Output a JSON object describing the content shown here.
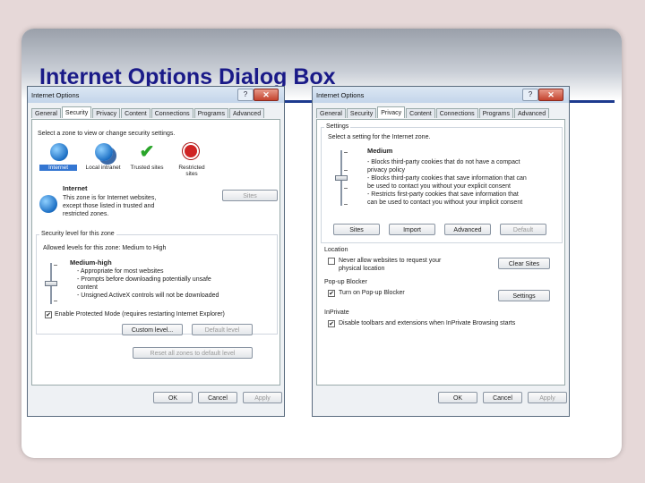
{
  "slide": {
    "title": "Internet Options Dialog Box"
  },
  "dialog_common": {
    "title": "Internet Options",
    "help": "?",
    "close": "✕",
    "tabs": [
      "General",
      "Security",
      "Privacy",
      "Content",
      "Connections",
      "Programs",
      "Advanced"
    ],
    "ok": "OK",
    "cancel": "Cancel",
    "apply": "Apply"
  },
  "security": {
    "active_tab": "Security",
    "select_zone": "Select a zone to view or change security settings.",
    "zones": [
      "Internet",
      "Local intranet",
      "Trusted sites",
      "Restricted sites"
    ],
    "zone_name": "Internet",
    "zone_desc": [
      "This zone is for Internet websites,",
      "except those listed in trusted and",
      "restricted zones."
    ],
    "sites_button": "Sites",
    "group_label": "Security level for this zone",
    "allowed_levels": "Allowed levels for this zone: Medium to High",
    "level_name": "Medium-high",
    "level_desc": [
      "- Appropriate for most websites",
      "- Prompts before downloading potentially unsafe",
      "  content",
      "- Unsigned ActiveX controls will not be downloaded"
    ],
    "protected_mode": "Enable Protected Mode (requires restarting Internet Explorer)",
    "custom_level": "Custom level...",
    "default_level": "Default level",
    "reset_all": "Reset all zones to default level",
    "slider_level": 0.5
  },
  "privacy": {
    "active_tab": "Privacy",
    "settings_label": "Settings",
    "select_setting": "Select a setting for the Internet zone.",
    "level_name": "Medium",
    "level_desc": [
      "- Blocks third-party cookies that do not have a compact",
      "  privacy policy",
      "- Blocks third-party cookies that save information that can",
      "  be used to contact you without your explicit consent",
      "- Restricts first-party cookies that save information that",
      "  can be used to contact you without your implicit consent"
    ],
    "buttons": [
      "Sites",
      "Import",
      "Advanced",
      "Default"
    ],
    "location_label": "Location",
    "location_check": [
      "Never allow websites to request your",
      "physical location"
    ],
    "clear_sites": "Clear Sites",
    "popup_label": "Pop-up Blocker",
    "popup_check": "Turn on Pop-up Blocker",
    "settings_button": "Settings",
    "inprivate_label": "InPrivate",
    "inprivate_check": "Disable toolbars and extensions when InPrivate Browsing starts",
    "slider_level": 0.5
  }
}
